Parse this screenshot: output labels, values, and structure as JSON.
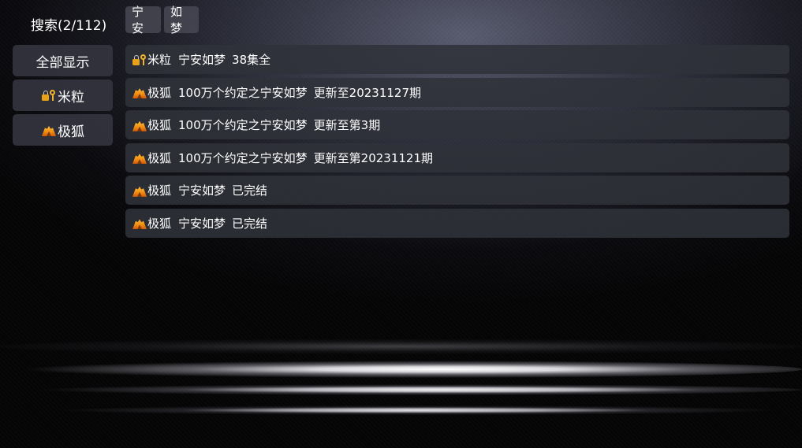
{
  "sidebar": {
    "search_title": "搜索(2/112)",
    "filters": [
      {
        "label": "全部显示",
        "icon": ""
      },
      {
        "label": "米粒",
        "icon": "lock-key-icon"
      },
      {
        "label": "极狐",
        "icon": "fox-icon"
      }
    ]
  },
  "keywords": [
    "宁安",
    "如梦"
  ],
  "results": [
    {
      "icon": "lock-key-icon",
      "site": "米粒",
      "title": "宁安如梦",
      "status": "38集全"
    },
    {
      "icon": "fox-icon",
      "site": "极狐",
      "title": "100万个约定之宁安如梦",
      "status": "更新至20231127期"
    },
    {
      "icon": "fox-icon",
      "site": "极狐",
      "title": "100万个约定之宁安如梦",
      "status": "更新至第3期"
    },
    {
      "icon": "fox-icon",
      "site": "极狐",
      "title": "100万个约定之宁安如梦",
      "status": "更新至第20231121期"
    },
    {
      "icon": "fox-icon",
      "site": "极狐",
      "title": "宁安如梦",
      "status": "已完结"
    },
    {
      "icon": "fox-icon",
      "site": "极狐",
      "title": "宁安如梦",
      "status": "已完结"
    }
  ],
  "colors": {
    "background": "#0b0b0f",
    "row_background": "#30323a",
    "button_background": "#343640",
    "chip_background": "#464852",
    "icon_gold": "#f0b32a",
    "icon_orange": "#f08a12"
  }
}
